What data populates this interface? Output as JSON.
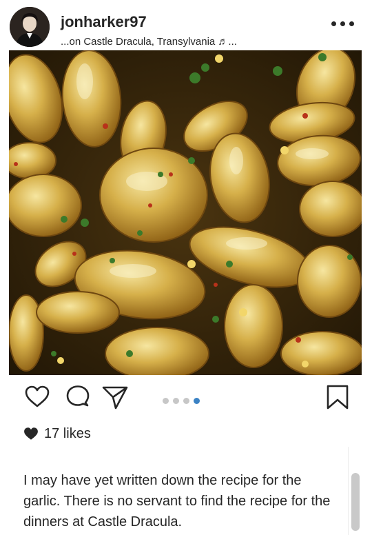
{
  "post": {
    "username": "jonharker97",
    "location": "...on   Castle Dracula, Transylvania ♬...",
    "likes_count": "17 likes",
    "caption": "I may have yet written down the recipe for the garlic. There is no servant to find the recipe for the dinners at Castle Dracula.",
    "carousel": {
      "total": 4,
      "current": 4
    }
  },
  "icons": {
    "more": "more-options-icon",
    "like": "heart-outline-icon",
    "comment": "comment-bubble-icon",
    "share": "paper-plane-icon",
    "save": "bookmark-icon",
    "liked": "heart-filled-icon"
  },
  "colors": {
    "text": "#262626",
    "active_dot": "#3b82c4",
    "inactive_dot": "#c7c7c7"
  }
}
